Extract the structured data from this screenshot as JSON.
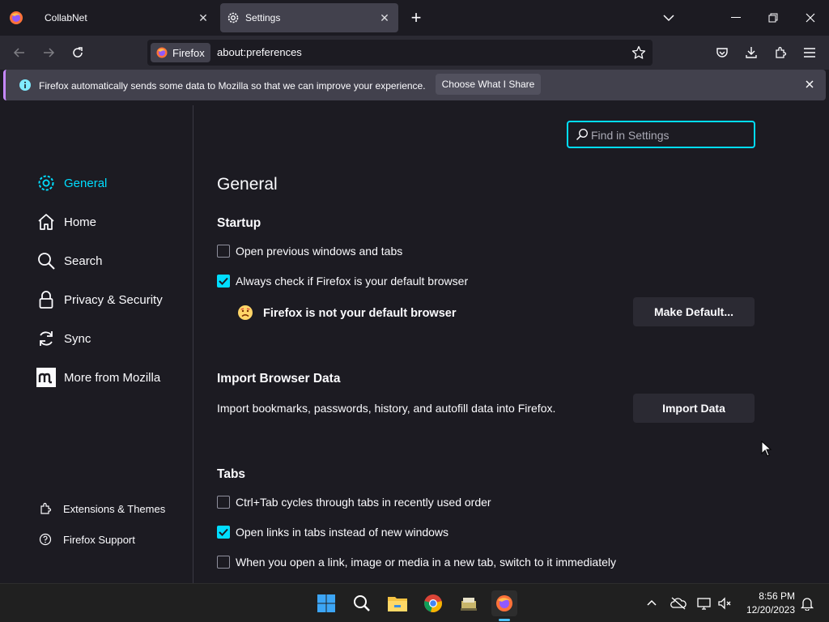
{
  "tabs": [
    {
      "title": "CollabNet",
      "active": false
    },
    {
      "title": "Settings",
      "active": true
    }
  ],
  "url_bar": {
    "identity_label": "Firefox",
    "url": "about:preferences"
  },
  "notification": {
    "message": "Firefox automatically sends some data to Mozilla so that we can improve your experience.",
    "button_label": "Choose What I Share"
  },
  "search": {
    "placeholder": "Find in Settings"
  },
  "sidebar": {
    "categories": [
      {
        "label": "General",
        "icon": "gear-icon",
        "selected": true
      },
      {
        "label": "Home",
        "icon": "home-icon",
        "selected": false
      },
      {
        "label": "Search",
        "icon": "search-icon",
        "selected": false
      },
      {
        "label": "Privacy & Security",
        "icon": "lock-icon",
        "selected": false
      },
      {
        "label": "Sync",
        "icon": "sync-icon",
        "selected": false
      },
      {
        "label": "More from Mozilla",
        "icon": "mozilla-icon",
        "selected": false
      }
    ],
    "footer": [
      {
        "label": "Extensions & Themes",
        "icon": "puzzle-icon"
      },
      {
        "label": "Firefox Support",
        "icon": "help-icon"
      }
    ]
  },
  "main": {
    "title": "General",
    "startup": {
      "heading": "Startup",
      "open_previous": {
        "label": "Open previous windows and tabs",
        "checked": false
      },
      "check_default": {
        "label": "Always check if Firefox is your default browser",
        "checked": true
      },
      "default_status": "Firefox is not your default browser",
      "make_default_label": "Make Default..."
    },
    "import": {
      "heading": "Import Browser Data",
      "description": "Import bookmarks, passwords, history, and autofill data into Firefox.",
      "button_label": "Import Data"
    },
    "tabs_section": {
      "heading": "Tabs",
      "options": [
        {
          "label": "Ctrl+Tab cycles through tabs in recently used order",
          "checked": false
        },
        {
          "label": "Open links in tabs instead of new windows",
          "checked": true
        },
        {
          "label": "When you open a link, image or media in a new tab, switch to it immediately",
          "checked": false
        }
      ]
    }
  },
  "taskbar": {
    "time": "8:56 PM",
    "date": "12/20/2023"
  },
  "colors": {
    "accent": "#00ddff",
    "background": "#1c1b22",
    "toolbar": "#2b2a33"
  }
}
